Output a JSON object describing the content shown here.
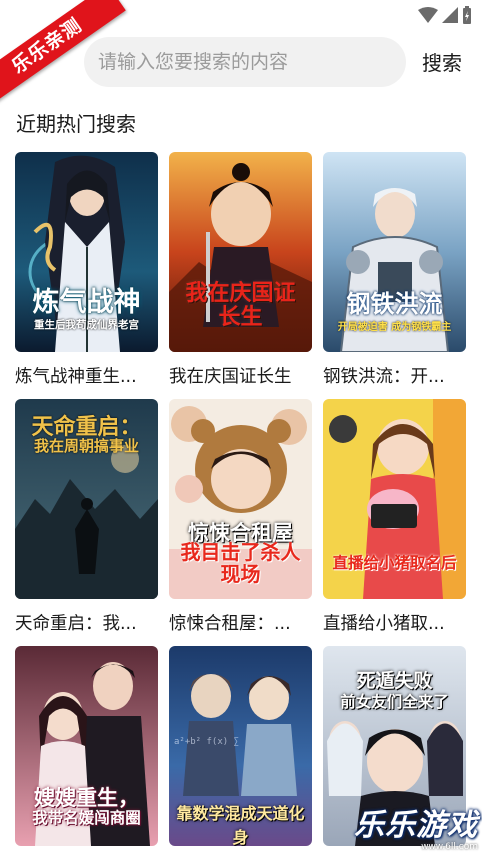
{
  "ribbon": {
    "text": "乐乐亲测"
  },
  "search": {
    "placeholder": "请输入您要搜索的内容",
    "value": "",
    "button_label": "搜索"
  },
  "section": {
    "title": "近期热门搜索"
  },
  "books": [
    {
      "title": "炼气战神重生后我苟成仙界老祖",
      "display_title": "炼气战神重生...",
      "cover_title": "炼气战神",
      "cover_subtitle": "重生后我苟成仙界老宫"
    },
    {
      "title": "我在庆国证长生",
      "display_title": "我在庆国证长生",
      "cover_title": "我在庆国证长生",
      "cover_subtitle": ""
    },
    {
      "title": "钢铁洪流：开局",
      "display_title": "钢铁洪流：开...",
      "cover_title": "钢铁洪流",
      "cover_subtitle": "开局被迫害 成为钢铁霸主"
    },
    {
      "title": "天命重启：我在周朝搞事业",
      "display_title": "天命重启：我...",
      "cover_title": "天命重启：",
      "cover_subtitle": "我在周朝搞事业"
    },
    {
      "title": "惊悚合租屋：我目击了杀人现场",
      "display_title": "惊悚合租屋：...",
      "cover_title": "惊悚合租屋",
      "cover_subtitle": "我目击了杀人现场"
    },
    {
      "title": "直播给小猪取名后",
      "display_title": "直播给小猪取...",
      "cover_title": "直播给小猪取名后",
      "cover_subtitle": ""
    },
    {
      "title": "嫂嫂重生，我带名媛闯商圈",
      "display_title": "",
      "cover_title": "嫂嫂重生，",
      "cover_subtitle": "我带名媛闯商圈"
    },
    {
      "title": "靠数学混成天道化身",
      "display_title": "",
      "cover_title": "靠数学混成天道化身",
      "cover_subtitle": ""
    },
    {
      "title": "死遁失败 前女友们全来了",
      "display_title": "",
      "cover_title": "死遁失败",
      "cover_subtitle": "前女友们全来了"
    }
  ],
  "watermark": {
    "text": "乐乐游戏",
    "url": "www.6ll.com"
  },
  "colors": {
    "ribbon": "#e0141b",
    "search_bg": "#f1f1f1",
    "text": "#1a1a1a",
    "placeholder": "#9b9b9b"
  }
}
